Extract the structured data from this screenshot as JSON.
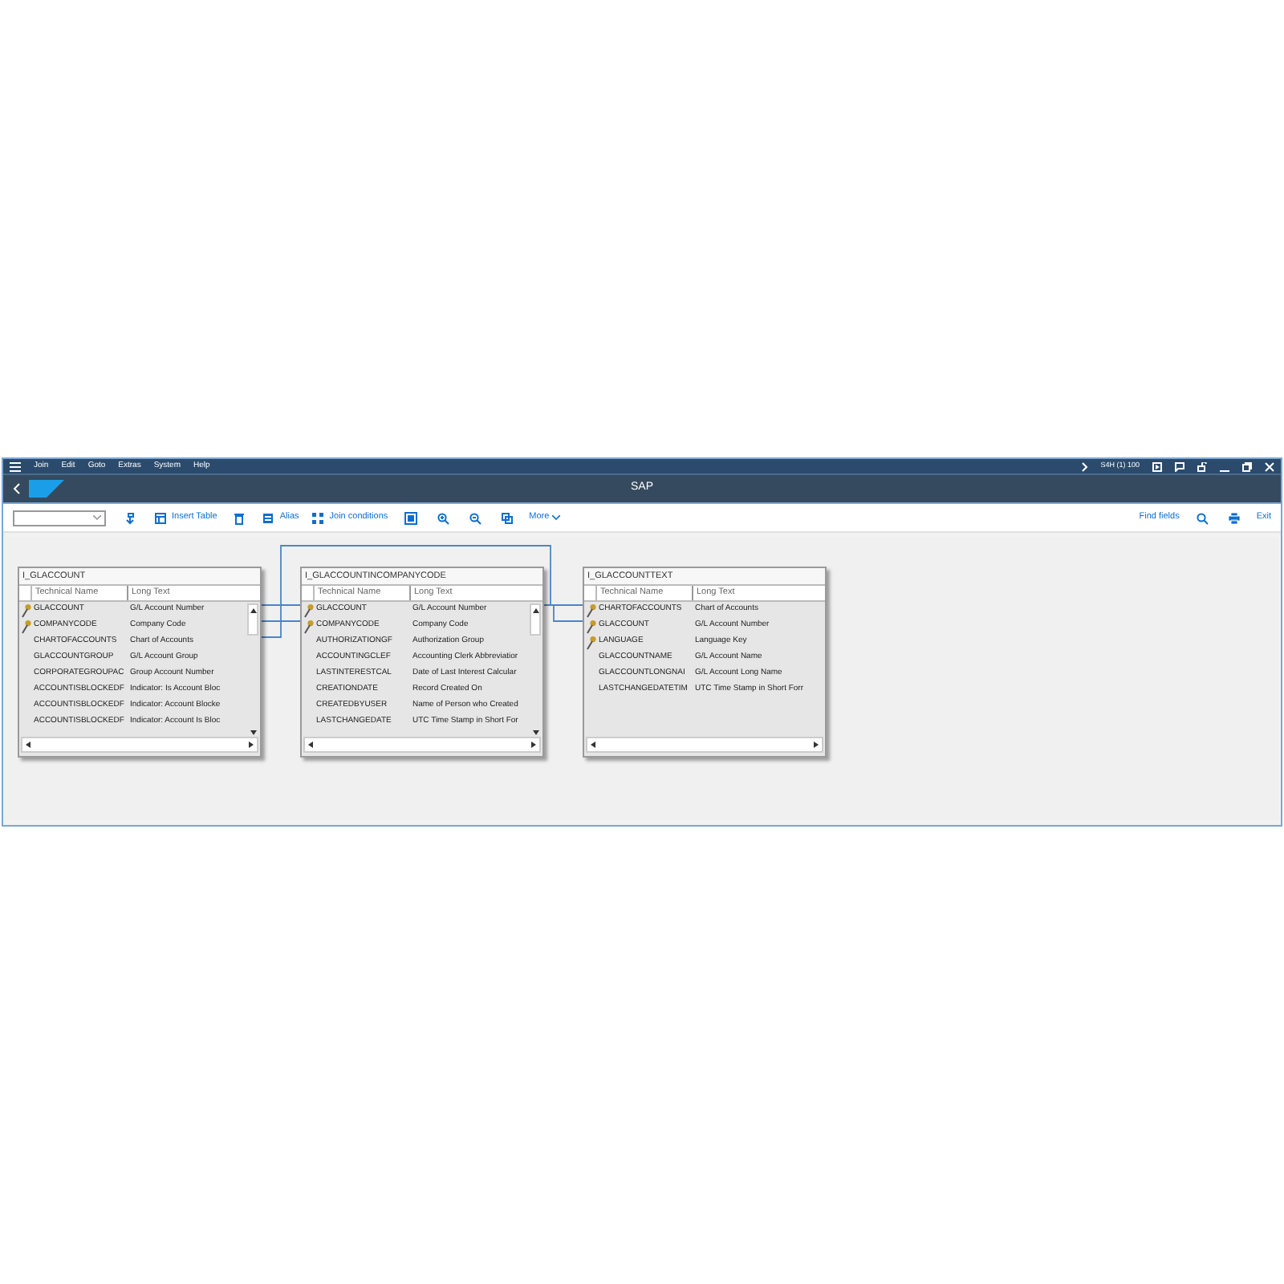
{
  "menu": [
    "Join",
    "Edit",
    "Goto",
    "Extras",
    "System",
    "Help"
  ],
  "system_info": "S4H (1) 100",
  "title": "SAP",
  "toolbar": {
    "left": [
      {
        "kind": "icon"
      },
      {
        "kind": "button",
        "label": "Insert Table"
      },
      {
        "kind": "icon"
      },
      {
        "kind": "button",
        "label": "Alias"
      },
      {
        "kind": "button",
        "label": "Join conditions"
      },
      {
        "kind": "icon"
      },
      {
        "kind": "icon"
      },
      {
        "kind": "icon"
      },
      {
        "kind": "icon"
      },
      {
        "kind": "menu",
        "label": "More"
      }
    ],
    "right": [
      {
        "kind": "button",
        "label": "Find fields"
      },
      {
        "kind": "icon"
      },
      {
        "kind": "icon"
      },
      {
        "kind": "button",
        "label": "Exit"
      }
    ]
  },
  "tables": [
    {
      "name": "I_GLACCOUNT",
      "columns": [
        "Technical Name",
        "Long Text"
      ],
      "rows": [
        {
          "technical_name": "GLACCOUNT",
          "long_text": "G/L Account Number",
          "key": true
        },
        {
          "technical_name": "COMPANYCODE",
          "long_text": "Company Code",
          "key": true
        },
        {
          "technical_name": "CHARTOFACCOUNTS",
          "long_text": "Chart of Accounts",
          "key": false
        },
        {
          "technical_name": "GLACCOUNTGROUP",
          "long_text": "G/L Account Group",
          "key": false
        },
        {
          "technical_name": "CORPORATEGROUPAC",
          "long_text": "Group Account Number",
          "key": false
        },
        {
          "technical_name": "ACCOUNTISBLOCKEDF",
          "long_text": "Indicator: Is Account Bloc",
          "key": false
        },
        {
          "technical_name": "ACCOUNTISBLOCKEDF",
          "long_text": "Indicator: Account Blocke",
          "key": false
        },
        {
          "technical_name": "ACCOUNTISBLOCKEDF",
          "long_text": "Indicator: Account Is Bloc",
          "key": false
        }
      ]
    },
    {
      "name": "I_GLACCOUNTINCOMPANYCODE",
      "columns": [
        "Technical Name",
        "Long Text"
      ],
      "rows": [
        {
          "technical_name": "GLACCOUNT",
          "long_text": "G/L Account Number",
          "key": true
        },
        {
          "technical_name": "COMPANYCODE",
          "long_text": "Company Code",
          "key": true
        },
        {
          "technical_name": "AUTHORIZATIONGF",
          "long_text": "Authorization Group",
          "key": false
        },
        {
          "technical_name": "ACCOUNTINGCLEF",
          "long_text": "Accounting Clerk Abbreviatior",
          "key": false
        },
        {
          "technical_name": "LASTINTERESTCAL",
          "long_text": "Date of Last Interest Calcular",
          "key": false
        },
        {
          "technical_name": "CREATIONDATE",
          "long_text": "Record Created On",
          "key": false
        },
        {
          "technical_name": "CREATEDBYUSER",
          "long_text": "Name of Person who Created",
          "key": false
        },
        {
          "technical_name": "LASTCHANGEDATE",
          "long_text": "UTC Time Stamp in Short For",
          "key": false
        }
      ]
    },
    {
      "name": "I_GLACCOUNTTEXT",
      "columns": [
        "Technical Name",
        "Long Text"
      ],
      "rows": [
        {
          "technical_name": "CHARTOFACCOUNTS",
          "long_text": "Chart of Accounts",
          "key": true
        },
        {
          "technical_name": "GLACCOUNT",
          "long_text": "G/L Account Number",
          "key": true
        },
        {
          "technical_name": "LANGUAGE",
          "long_text": "Language Key",
          "key": true
        },
        {
          "technical_name": "GLACCOUNTNAME",
          "long_text": "G/L Account Name",
          "key": false
        },
        {
          "technical_name": "GLACCOUNTLONGNAI",
          "long_text": "G/L Account Long Name",
          "key": false
        },
        {
          "technical_name": "LASTCHANGEDATETIM",
          "long_text": "UTC Time Stamp in Short Forr",
          "key": false
        }
      ]
    }
  ]
}
